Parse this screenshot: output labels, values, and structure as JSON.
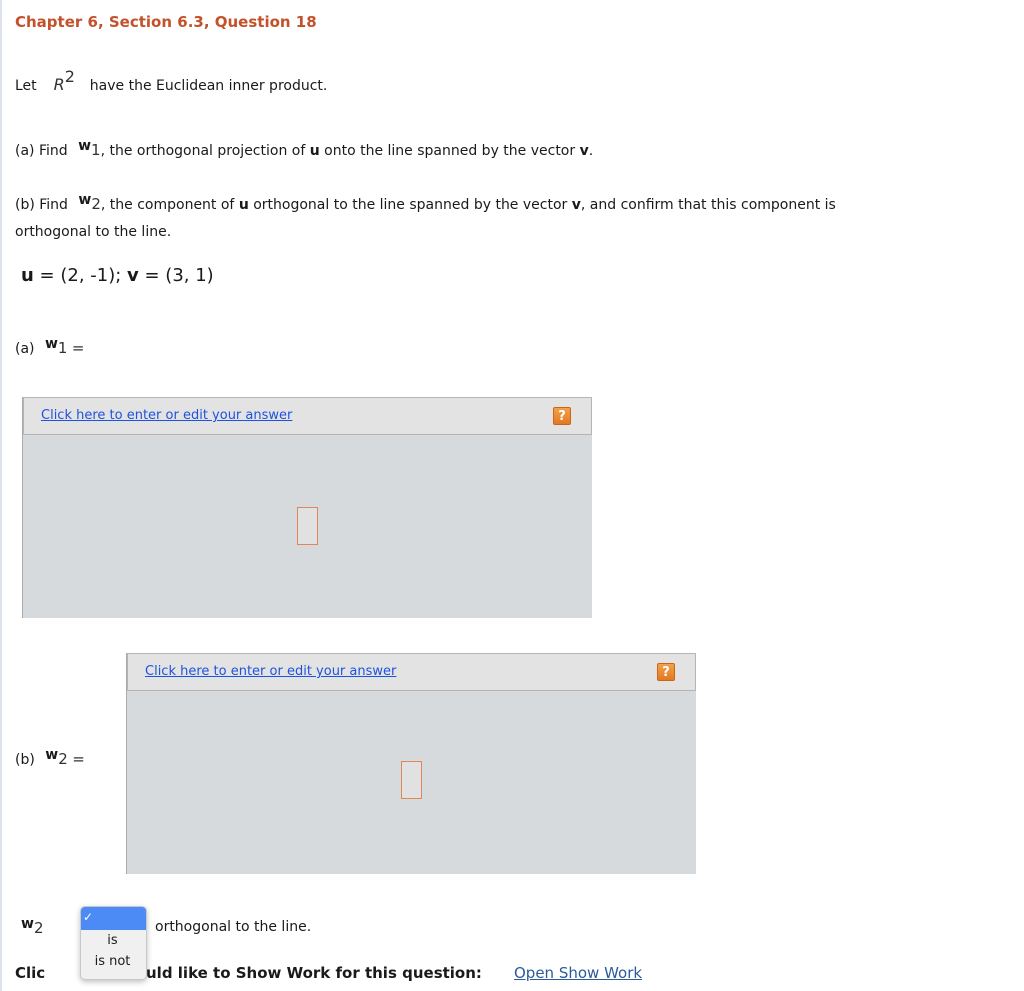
{
  "header": {
    "title": "Chapter 6, Section 6.3, Question 18"
  },
  "problem": {
    "intro_pre": "Let",
    "space_symbol": "R",
    "space_exponent": "2",
    "intro_post": "have the Euclidean inner product.",
    "part_a_prefix": "(a) Find",
    "part_a_vector": "w",
    "part_a_sub": "1",
    "part_a_text_1": ", the orthogonal projection of ",
    "part_a_bold_u": "u",
    "part_a_text_2": " onto the line spanned by the vector ",
    "part_a_bold_v": "v",
    "part_a_text_3": ".",
    "part_b_prefix": "(b) Find",
    "part_b_vector": "w",
    "part_b_sub": "2",
    "part_b_text_1": ", the component of ",
    "part_b_bold_u": "u",
    "part_b_text_2": " orthogonal to the line spanned by the vector ",
    "part_b_bold_v": "v",
    "part_b_text_3": ", and confirm that this component is",
    "part_b_line2": "orthogonal to the line.",
    "given": {
      "u_label": "u",
      "u_value": " = (2, -1); ",
      "v_label": "v",
      "v_value": " = (3, 1)"
    }
  },
  "answers": {
    "a": {
      "label": "(a)",
      "vector": "w",
      "sub": "1",
      "eq": "=",
      "link": "Click here to enter or edit your answer",
      "help": "?"
    },
    "b": {
      "label": "(b)",
      "vector": "w",
      "sub": "2",
      "eq": "=",
      "link": "Click here to enter or edit your answer",
      "help": "?"
    }
  },
  "confirm": {
    "vector": "w",
    "sub": "2",
    "text": "orthogonal to the line.",
    "dropdown": {
      "selected_check": "✓",
      "selected_value": "",
      "options": [
        "is",
        "is not"
      ]
    }
  },
  "show_work": {
    "text_visible_left": "Clic",
    "text_visible_right": "uld like to Show Work for this question:",
    "link": "Open Show Work"
  },
  "colors": {
    "title": "#c4512a",
    "link": "#1e52e0",
    "help_icon": "#e88a32",
    "dropdown_selected": "#4c8bf5"
  }
}
